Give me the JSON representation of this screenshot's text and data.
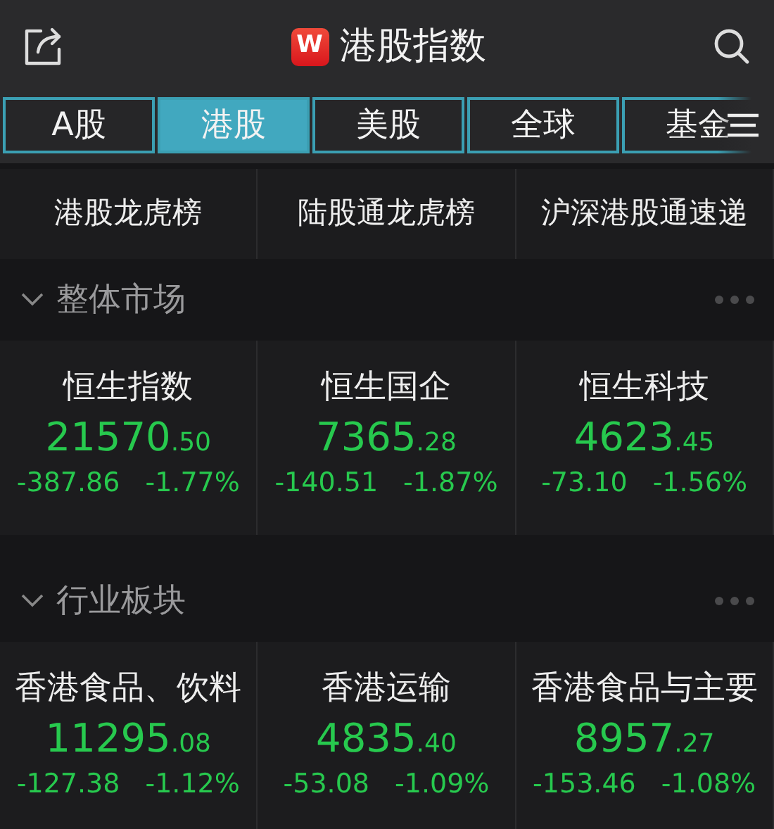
{
  "header": {
    "title": "港股指数",
    "logo": "W"
  },
  "tabs": [
    {
      "label": "A股",
      "selected": false
    },
    {
      "label": "港股",
      "selected": true
    },
    {
      "label": "美股",
      "selected": false
    },
    {
      "label": "全球",
      "selected": false
    },
    {
      "label": "基金",
      "selected": false
    }
  ],
  "links": [
    "港股龙虎榜",
    "陆股通龙虎榜",
    "沪深港股通速递"
  ],
  "sections": [
    {
      "title": "整体市场",
      "expanded": true,
      "cards": [
        {
          "name": "恒生指数",
          "value": "21570",
          "decimals": ".50",
          "change": "-387.86",
          "percent": "-1.77%"
        },
        {
          "name": "恒生国企",
          "value": "7365",
          "decimals": ".28",
          "change": "-140.51",
          "percent": "-1.87%"
        },
        {
          "name": "恒生科技",
          "value": "4623",
          "decimals": ".45",
          "change": "-73.10",
          "percent": "-1.56%"
        }
      ]
    },
    {
      "title": "行业板块",
      "expanded": true,
      "cards": [
        {
          "name": "香港食品、饮料",
          "value": "11295",
          "decimals": ".08",
          "change": "-127.38",
          "percent": "-1.12%"
        },
        {
          "name": "香港运输",
          "value": "4835",
          "decimals": ".40",
          "change": "-53.08",
          "percent": "-1.09%"
        },
        {
          "name": "香港食品与主要",
          "value": "8957",
          "decimals": ".27",
          "change": "-153.46",
          "percent": "-1.08%"
        }
      ]
    }
  ]
}
